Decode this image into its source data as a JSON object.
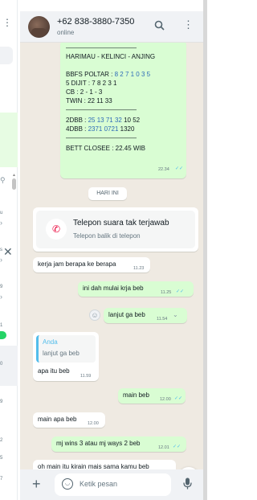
{
  "left_list": {
    "items": [
      "u",
      "s",
      "9",
      "1",
      "0",
      "9",
      "2",
      "5",
      "7"
    ],
    "badge": "1"
  },
  "header": {
    "contact": "+62 838-3880-7350",
    "status": "online",
    "search_icon": "search-icon",
    "menu_icon": "more-vert-icon"
  },
  "messages": {
    "result": {
      "divider_top": "———————————",
      "title": "HARIMAU - KELINCI - ANJING",
      "bbfs_label": "BBFS POLTAR : ",
      "bbfs_value": "8 2 7 1 0 3 5",
      "dijit": "5 DIJIT : 7 8 2 3 1",
      "cb": "CB   : 2 - 1 - 3",
      "twin": "TWIN : 22 11 33",
      "divider_mid": "———————————",
      "d2_label": "2DBB : ",
      "d2_blue": "25 13 71 32",
      "d2_black": " 10 52",
      "d4_label": "4DBB : ",
      "d4_blue": "2371 0721",
      "d4_black": " 1320",
      "divider_bot": "———————————",
      "close": "BETT CLOSEE : 22.45 WIB",
      "time": "22.34"
    },
    "day_label": "HARI INI",
    "call": {
      "title": "Telepon suara tak terjawab",
      "subtitle": "Telepon balik di telepon"
    },
    "m1": {
      "text": "kerja jam berapa ke berapa",
      "time": "11.23"
    },
    "m2": {
      "text": "ini dah mulai krja beb",
      "time": "11.25"
    },
    "m3": {
      "text": "lanjut ga beb",
      "time": "11.54"
    },
    "m4": {
      "quote_author": "Anda",
      "quote_text": "lanjut ga beb",
      "text": "apa itu beb",
      "time": "11.59"
    },
    "m5": {
      "text": "main beb",
      "time": "12.00"
    },
    "m6": {
      "text": "main apa beb",
      "time": "12.00"
    },
    "m7": {
      "text": "mj wins 3 atau mj ways 2 beb",
      "time": "12.01"
    },
    "m8": {
      "text": "oh main itu kirain mais sama kamu beb"
    }
  },
  "composer": {
    "placeholder": "Ketik pesan"
  },
  "colors": {
    "outgoing": "#d9fdd3",
    "incoming": "#ffffff",
    "read_tick": "#53bdeb",
    "background": "#efeae2"
  }
}
